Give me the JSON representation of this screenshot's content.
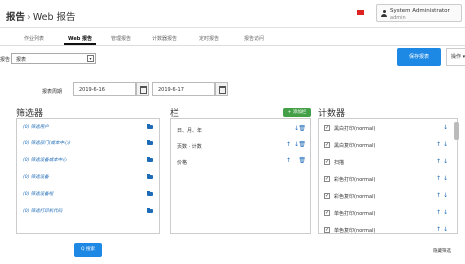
{
  "header": {
    "title_main": "报告",
    "separator": "›",
    "title_sub": "Web 报告",
    "user_name": "System Administrator",
    "user_role": "admin"
  },
  "tabs": [
    {
      "label": "作业列表",
      "active": false
    },
    {
      "label": "Web 报告",
      "active": true
    },
    {
      "label": "管理报告",
      "active": false
    },
    {
      "label": "计数器报告",
      "active": false
    },
    {
      "label": "定时报告",
      "active": false
    },
    {
      "label": "报告访问",
      "active": false
    }
  ],
  "toolbar": {
    "report_label": "报告",
    "report_select": "报表",
    "save_button": "保存报表",
    "operation_button": "操作"
  },
  "period": {
    "label": "报表周期",
    "start": "2019-6-16",
    "end": "2019-6-17"
  },
  "filters": {
    "title": "筛选器",
    "items": [
      "(0) 筛选用户",
      "(0) 筛选部门(成本中心)",
      "(0) 筛选设备成本中心",
      "(0) 筛选设备",
      "(0) 筛选设备组",
      "(0) 筛选打印机代码"
    ]
  },
  "columns": {
    "title": "栏",
    "add_button": "+ 添加栏",
    "items": [
      "日、月、年",
      "页数 · 计数",
      "价格"
    ]
  },
  "counters": {
    "title": "计数器",
    "items": [
      "黑白打印(normal)",
      "黑白复印(normal)",
      "扫描",
      "彩色打印(normal)",
      "彩色复印(normal)",
      "单色打印(normal)",
      "单色复印(normal)"
    ]
  },
  "footer": {
    "search_button": "Q 搜索",
    "hide_link": "隐藏筛选"
  },
  "colors": {
    "accent": "#1e88e5",
    "add_green": "#43a047",
    "flag_red": "#dd2222",
    "link_blue": "#1e6bb8"
  }
}
